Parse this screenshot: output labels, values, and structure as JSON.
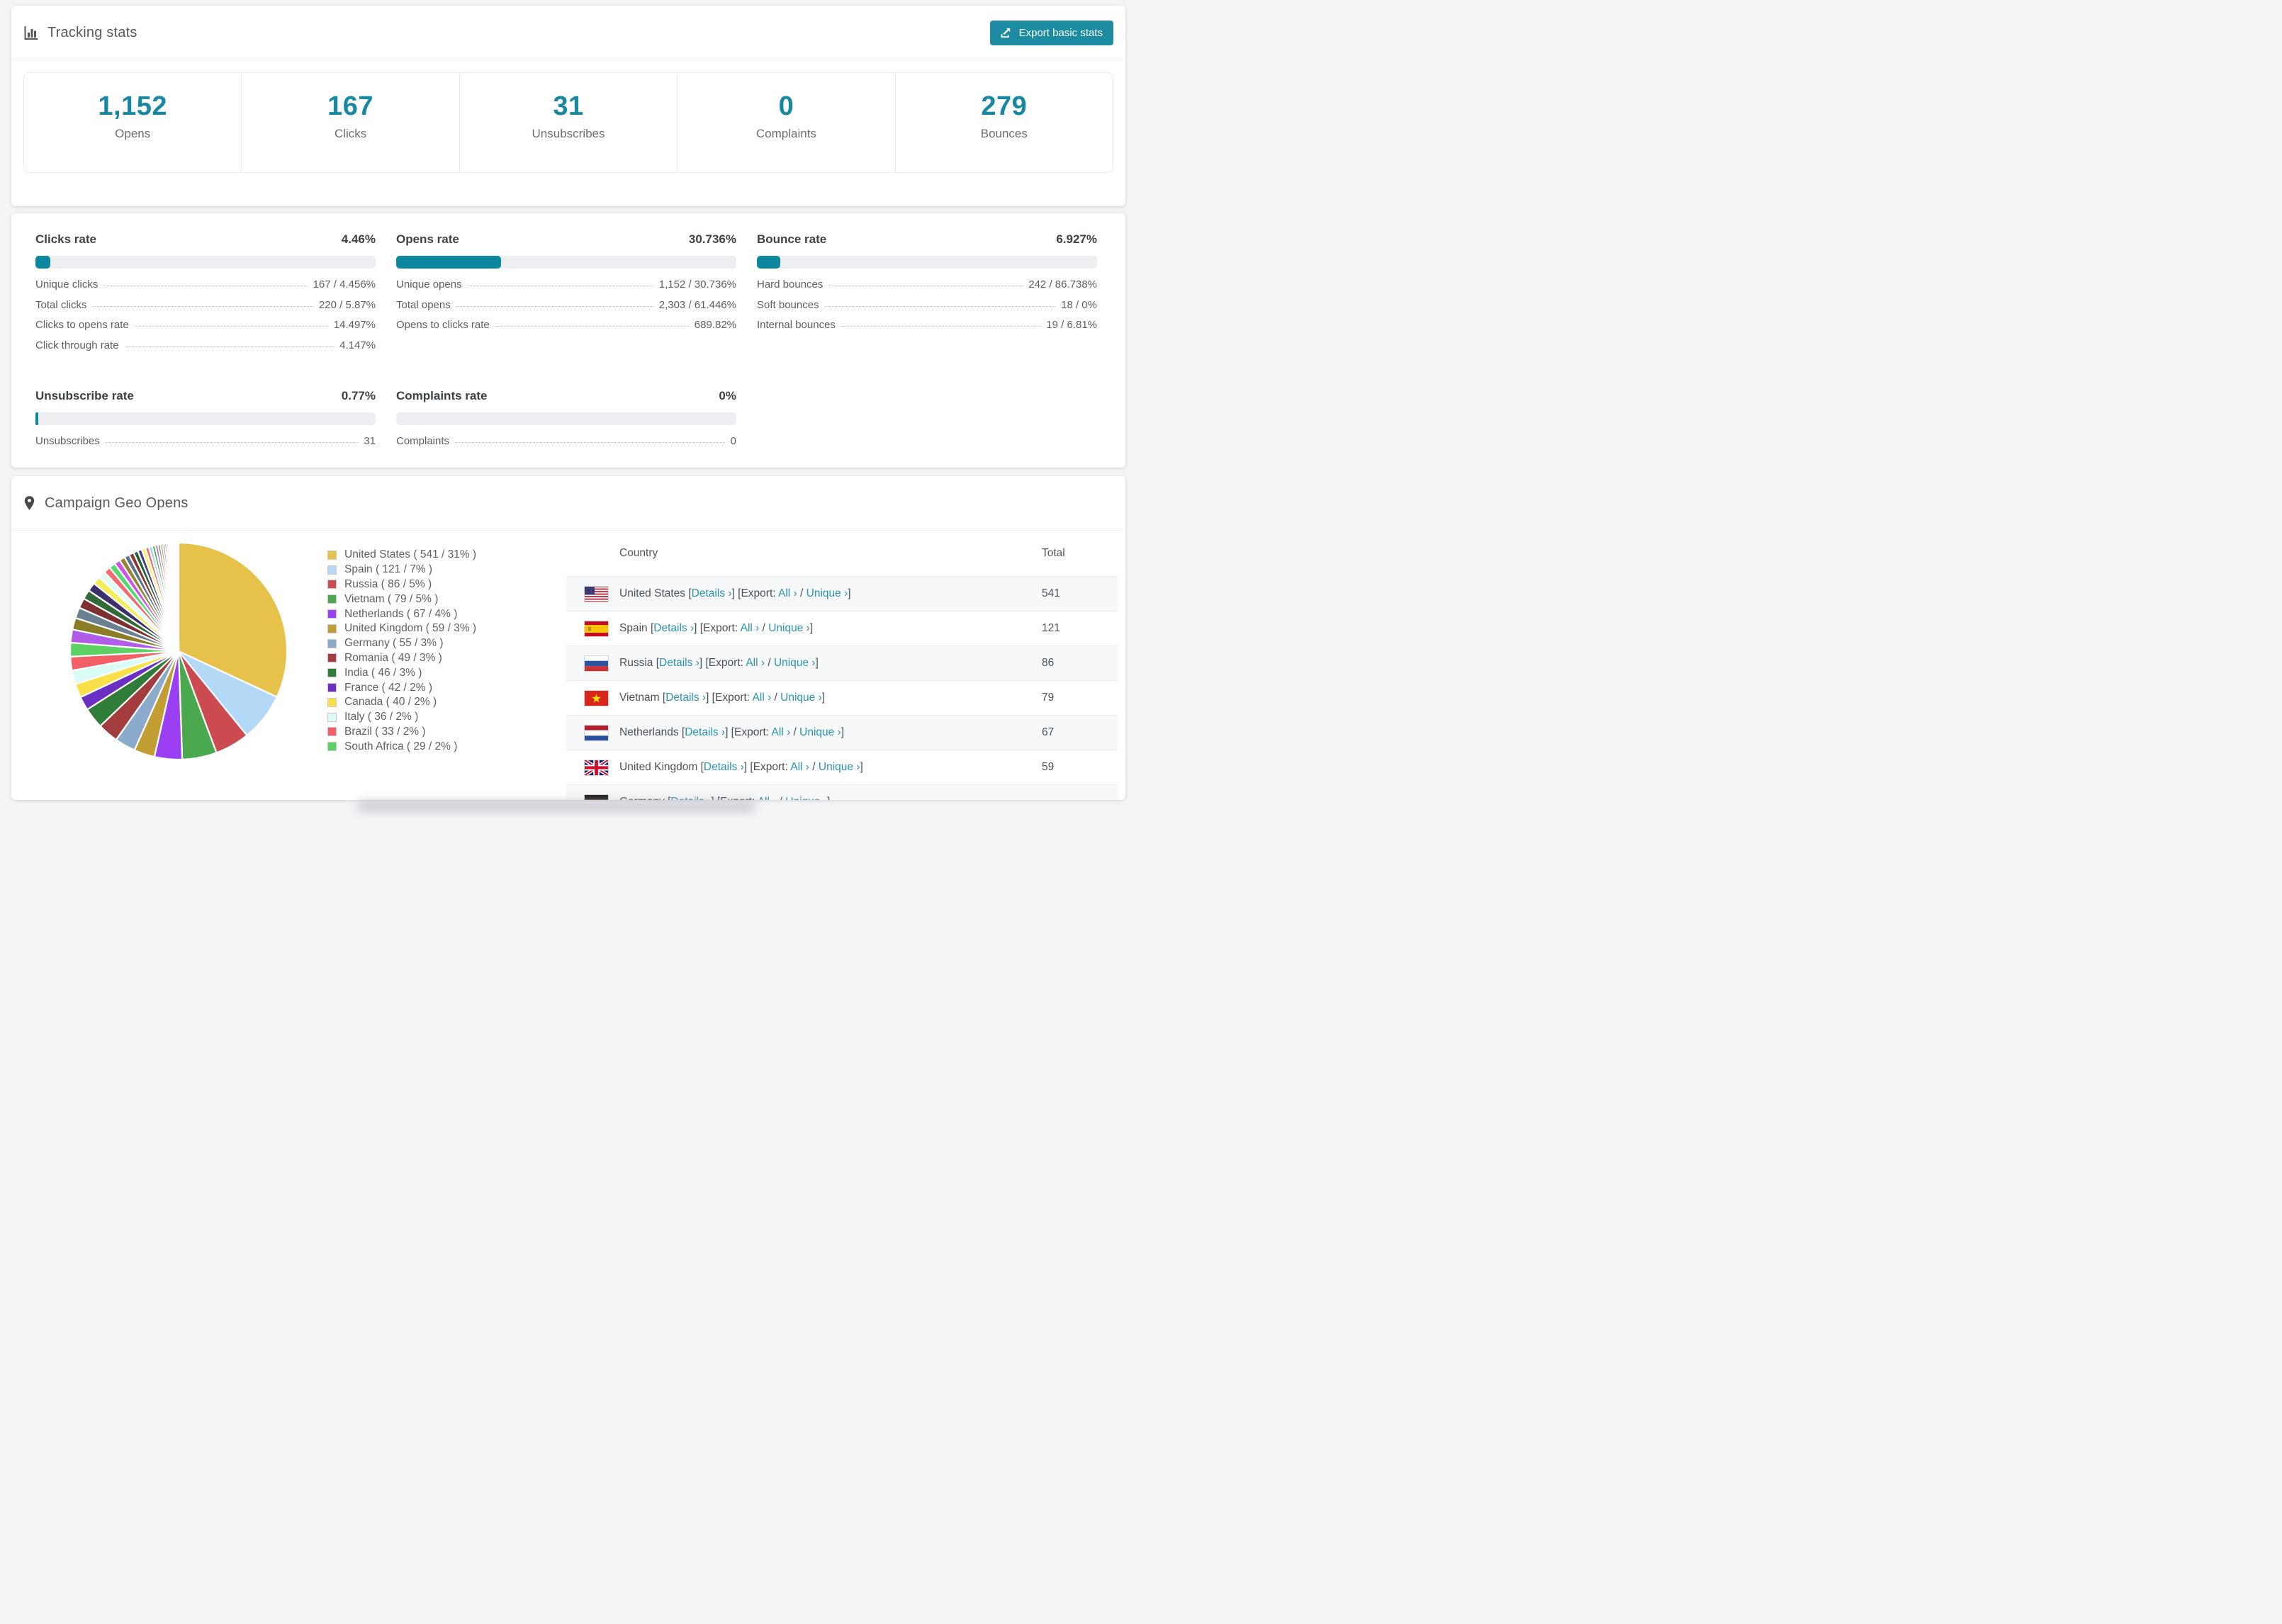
{
  "page": {
    "background": "#f3f4f6",
    "accent_teal": "#0d87a0",
    "link_teal": "#2a93b4"
  },
  "tracking": {
    "title": "Tracking stats",
    "export_button": "Export basic stats",
    "summary": [
      {
        "value": "1,152",
        "label": "Opens"
      },
      {
        "value": "167",
        "label": "Clicks"
      },
      {
        "value": "31",
        "label": "Unsubscribes"
      },
      {
        "value": "0",
        "label": "Complaints"
      },
      {
        "value": "279",
        "label": "Bounces"
      }
    ]
  },
  "rates": {
    "blocks": [
      {
        "title": "Clicks rate",
        "value": "4.46%",
        "percent": 4.46,
        "rows": [
          {
            "label": "Unique clicks",
            "value": "167 / 4.456%"
          },
          {
            "label": "Total clicks",
            "value": "220 / 5.87%"
          },
          {
            "label": "Clicks to opens rate",
            "value": "14.497%"
          },
          {
            "label": "Click through rate",
            "value": "4.147%"
          }
        ]
      },
      {
        "title": "Opens rate",
        "value": "30.736%",
        "percent": 30.736,
        "rows": [
          {
            "label": "Unique opens",
            "value": "1,152 / 30.736%"
          },
          {
            "label": "Total opens",
            "value": "2,303 / 61.446%"
          },
          {
            "label": "Opens to clicks rate",
            "value": "689.82%"
          }
        ]
      },
      {
        "title": "Bounce rate",
        "value": "6.927%",
        "percent": 6.927,
        "rows": [
          {
            "label": "Hard bounces",
            "value": "242 / 86.738%"
          },
          {
            "label": "Soft bounces",
            "value": "18 / 0%"
          },
          {
            "label": "Internal bounces",
            "value": "19 / 6.81%"
          }
        ]
      },
      {
        "title": "Unsubscribe rate",
        "value": "0.77%",
        "percent": 0.77,
        "rows": [
          {
            "label": "Unsubscribes",
            "value": "31"
          }
        ]
      },
      {
        "title": "Complaints rate",
        "value": "0%",
        "percent": 0,
        "rows": [
          {
            "label": "Complaints",
            "value": "0"
          }
        ]
      }
    ]
  },
  "geo": {
    "title": "Campaign Geo Opens",
    "table": {
      "col_country": "Country",
      "col_total": "Total",
      "details_label": "Details ›",
      "export_label": "Export:",
      "all_label": "All ›",
      "unique_label": "Unique ›",
      "rows": [
        {
          "country": "United States",
          "flag": "us",
          "total": "541"
        },
        {
          "country": "Spain",
          "flag": "es",
          "total": "121"
        },
        {
          "country": "Russia",
          "flag": "ru",
          "total": "86"
        },
        {
          "country": "Vietnam",
          "flag": "vn",
          "total": "79"
        },
        {
          "country": "Netherlands",
          "flag": "nl",
          "total": "67"
        },
        {
          "country": "United Kingdom",
          "flag": "gb",
          "total": "59"
        },
        {
          "country": "Germany",
          "flag": "de",
          "total": "",
          "partial": true
        }
      ]
    }
  },
  "chart_data": {
    "type": "pie",
    "title": "Campaign Geo Opens",
    "legend_position": "right",
    "slices": [
      {
        "label": "United States",
        "count": 541,
        "pct": 31,
        "color": "#e7c24a"
      },
      {
        "label": "Spain",
        "count": 121,
        "pct": 7,
        "color": "#b4d9f7"
      },
      {
        "label": "Russia",
        "count": 86,
        "pct": 5,
        "color": "#cb4b50"
      },
      {
        "label": "Vietnam",
        "count": 79,
        "pct": 5,
        "color": "#4aa84f"
      },
      {
        "label": "Netherlands",
        "count": 67,
        "pct": 4,
        "color": "#9b3ff2"
      },
      {
        "label": "United Kingdom",
        "count": 59,
        "pct": 3,
        "color": "#c29d34"
      },
      {
        "label": "Germany",
        "count": 55,
        "pct": 3,
        "color": "#8aabc9"
      },
      {
        "label": "Romania",
        "count": 49,
        "pct": 3,
        "color": "#a33d3d"
      },
      {
        "label": "India",
        "count": 46,
        "pct": 3,
        "color": "#2f7d39"
      },
      {
        "label": "France",
        "count": 42,
        "pct": 2,
        "color": "#6b2fc4"
      },
      {
        "label": "Canada",
        "count": 40,
        "pct": 2,
        "color": "#f9e04b"
      },
      {
        "label": "Italy",
        "count": 36,
        "pct": 2,
        "color": "#d9fcf7"
      },
      {
        "label": "Brazil",
        "count": 33,
        "pct": 2,
        "color": "#f26065"
      },
      {
        "label": "South Africa",
        "count": 29,
        "pct": 2,
        "color": "#5bd262"
      }
    ],
    "other_slices_pct": [
      1.9,
      1.7,
      1.55,
      1.45,
      1.35,
      1.25,
      1.15,
      1.05,
      0.98,
      0.92,
      0.86,
      0.8,
      0.75,
      0.7,
      0.65,
      0.6,
      0.56,
      0.52,
      0.48,
      0.44,
      0.4,
      0.36,
      0.33,
      0.3,
      0.27,
      0.24,
      0.21,
      0.19,
      0.17,
      0.15,
      0.13,
      0.11,
      0.1,
      0.09,
      0.08,
      0.07,
      0.06,
      0.05,
      0.04,
      0.03
    ],
    "other_slices_palette": [
      "#b05ce8",
      "#8b7c26",
      "#68808f",
      "#7e2f2f",
      "#2f6b37",
      "#3c2f6b",
      "#f3ee58",
      "#e2fbf7",
      "#f56a6e",
      "#55da72",
      "#cf54e6",
      "#968431",
      "#5c7489",
      "#8d3434",
      "#20603a",
      "#4a3d85",
      "#f7f06a",
      "#ef6a6a",
      "#a9d0ef",
      "#49b350"
    ]
  }
}
